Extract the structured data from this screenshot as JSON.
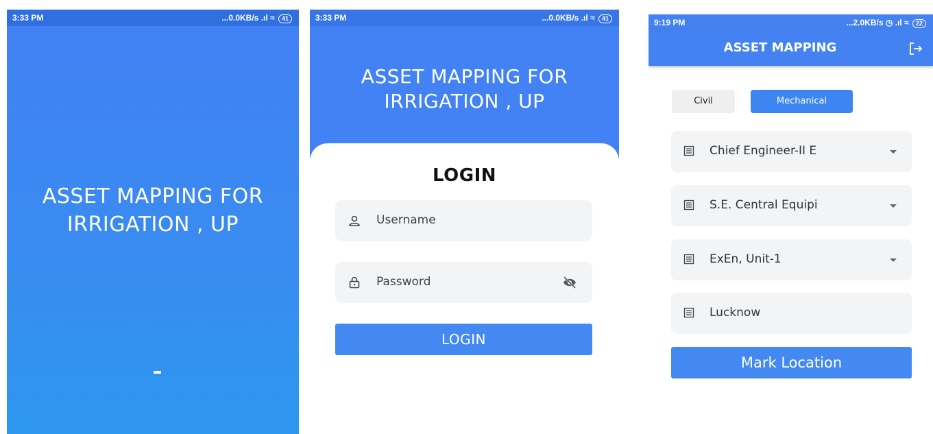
{
  "screens": [
    {
      "status": {
        "time": "3:33 PM",
        "network": "...0.0KB/s",
        "battery": "41"
      },
      "splash_title": "ASSET MAPPING FOR IRRIGATION , UP"
    },
    {
      "status": {
        "time": "3:33 PM",
        "network": "...0.0KB/s",
        "battery": "41"
      },
      "header_title": "ASSET MAPPING FOR IRRIGATION , UP",
      "login_heading": "LOGIN",
      "username_placeholder": "Username",
      "password_placeholder": "Password",
      "login_button": "LOGIN"
    },
    {
      "status": {
        "time": "9:19 PM",
        "network": "...2.0KB/s",
        "battery": "22"
      },
      "appbar_title": "ASSET MAPPING",
      "tabs": [
        {
          "label": "Civil",
          "selected": false
        },
        {
          "label": "Mechanical",
          "selected": true
        }
      ],
      "dropdowns": [
        {
          "value": "Chief Engineer-II E"
        },
        {
          "value": "S.E. Central Equipi"
        },
        {
          "value": "ExEn,  Unit-1"
        }
      ],
      "location_field": "Lucknow",
      "mark_button": "Mark Location"
    }
  ],
  "colors": {
    "primary": "#4282f4",
    "field_bg": "#f2f4f6",
    "button": "#4489f2"
  }
}
